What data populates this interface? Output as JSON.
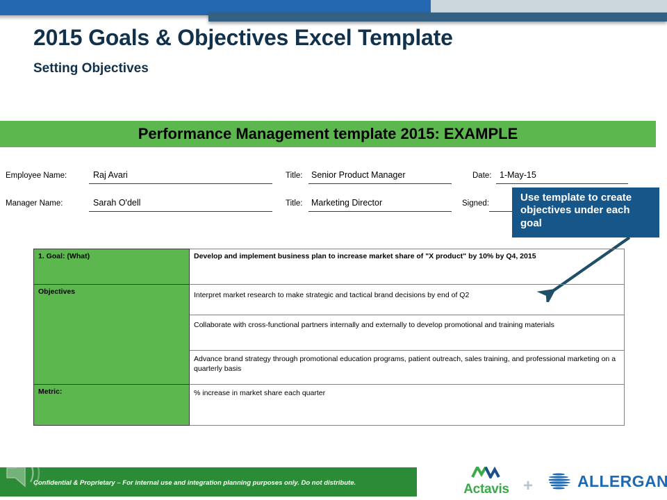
{
  "header": {
    "title": "2015 Goals & Objectives Excel Template",
    "subtitle": "Setting Objectives",
    "bar_blue_color": "#2368b0",
    "bar_gray_color": "#ccd6dd",
    "bar_dark_color": "#336083"
  },
  "banner": {
    "text": "Performance Management template 2015: EXAMPLE",
    "color": "#5cb84e"
  },
  "form": {
    "employee_name_label": "Employee Name:",
    "employee_name_value": "Raj Avari",
    "employee_title_label": "Title:",
    "employee_title_value": "Senior Product Manager",
    "date_label": "Date:",
    "date_value": "1-May-15",
    "manager_name_label": "Manager Name:",
    "manager_name_value": "Sarah O'dell",
    "manager_title_label": "Title:",
    "manager_title_value": "Marketing Director",
    "signed_label": "Signed:",
    "signed_value": ""
  },
  "callout": {
    "text": "Use template to create objectives under each goal",
    "bg_color": "#175689",
    "text_color": "#ffffff",
    "arrow_color": "#1f4e68"
  },
  "table": {
    "rows": [
      {
        "label": "1. Goal: (What)",
        "value": "Develop and implement business plan to increase market share of \"X product\" by 10% by Q4, 2015",
        "label_style": "green",
        "value_bold": true
      },
      {
        "label": "Objectives",
        "value": "Interpret market research to make strategic and tactical brand decisions by end of Q2",
        "label_style": "green",
        "value_bold": false
      },
      {
        "label": "",
        "value": "Collaborate with cross-functional partners internally and externally to develop promotional and training materials",
        "label_style": "green",
        "value_bold": false
      },
      {
        "label": "",
        "value": "Advance brand strategy through promotional education programs, patient outreach, sales training, and professional marketing on a quarterly basis",
        "label_style": "green",
        "value_bold": false
      },
      {
        "label": "Metric:",
        "value": "% increase in market share each quarter",
        "label_style": "green",
        "value_bold": false
      }
    ]
  },
  "footer": {
    "confidential_text": "Confidential & Proprietary  –  For internal use and integration planning purposes only. Do not distribute.",
    "bar_color": "#2c8b36",
    "speaker_icon": "speaker-icon",
    "actavis_name": "Actavis",
    "plus": "+",
    "allergan_name": "ALLERGAN",
    "actavis_color": "#3aaa49",
    "allergan_color": "#1f69b3"
  }
}
